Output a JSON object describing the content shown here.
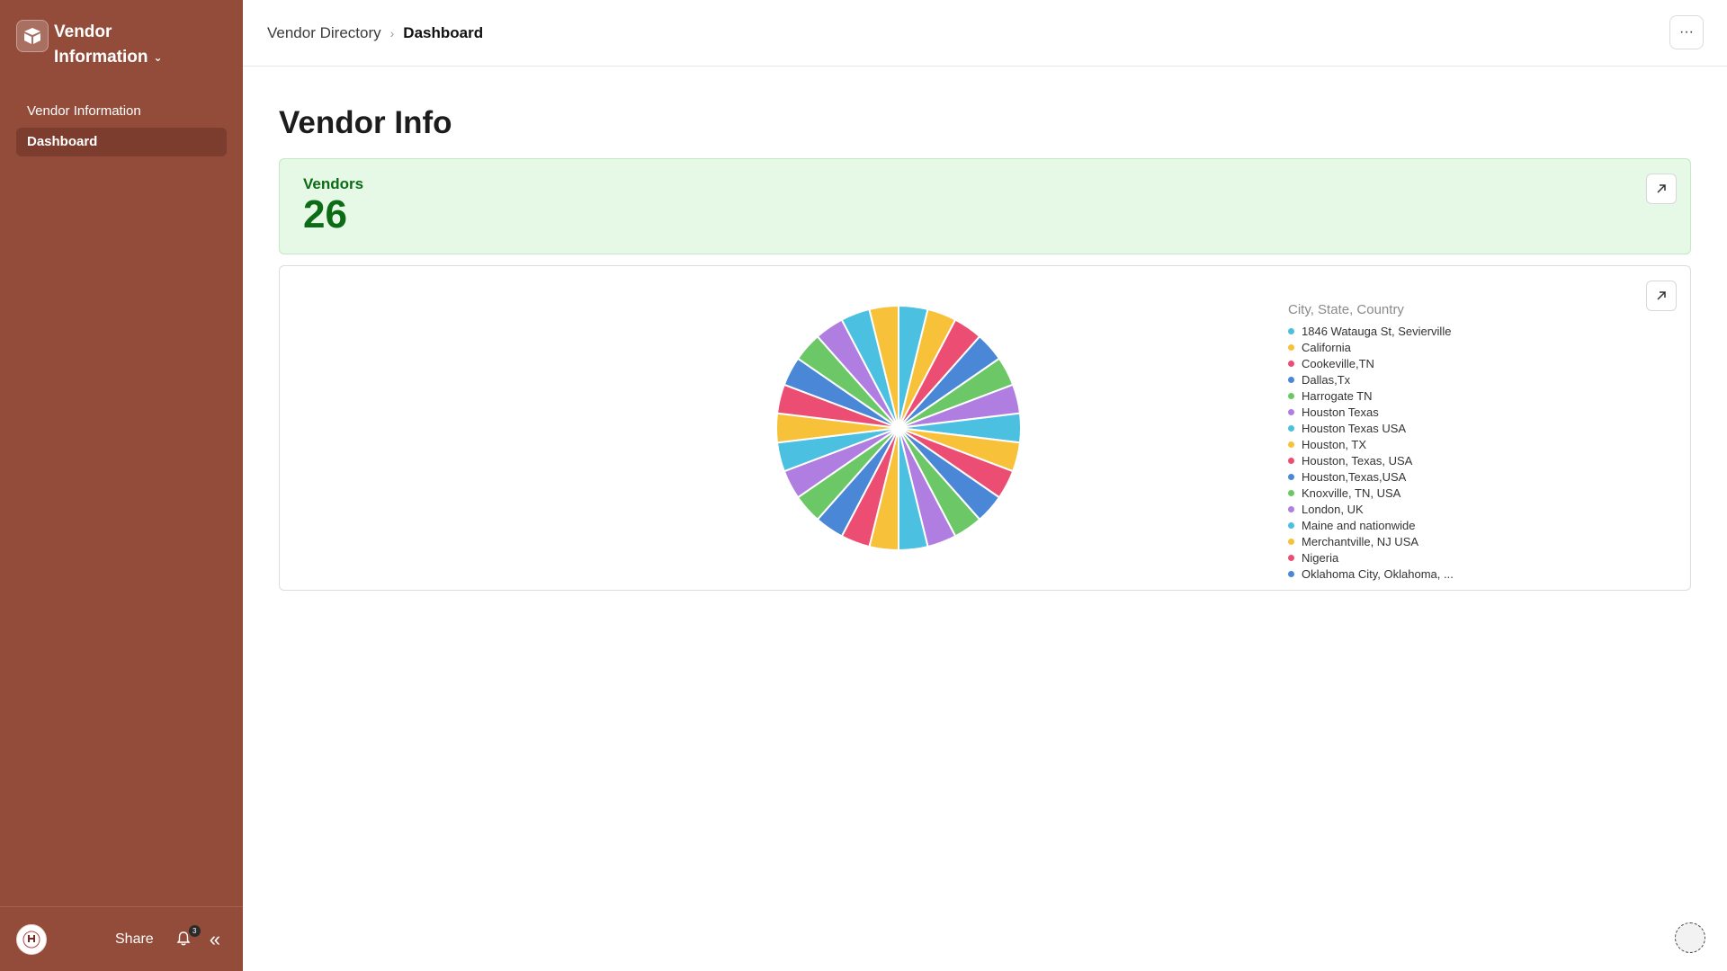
{
  "sidebar": {
    "brand_line1": "Vendor",
    "brand_line2": "Information",
    "items": [
      {
        "label": "Vendor Information",
        "active": false
      },
      {
        "label": "Dashboard",
        "active": true
      }
    ],
    "footer": {
      "share_label": "Share",
      "notification_count": "3",
      "bg_color": "#944c3a"
    }
  },
  "header": {
    "breadcrumb": [
      "Vendor Directory",
      "Dashboard"
    ],
    "more_label": "···"
  },
  "main": {
    "title": "Vendor Info",
    "metric": {
      "label": "Vendors",
      "value": "26",
      "color": "#0c6b15",
      "bg": "#e6f8e6"
    }
  },
  "chart_data": {
    "type": "pie",
    "legend_title": "City, State, Country",
    "colors": [
      "#4bc0e0",
      "#f8c13a",
      "#ec4d72",
      "#4a87d6",
      "#6cc866",
      "#b07ee0"
    ],
    "slices": [
      {
        "label": "1846 Watauga St, Sevierville",
        "value": 1
      },
      {
        "label": "California",
        "value": 1
      },
      {
        "label": "Cookeville,TN",
        "value": 1
      },
      {
        "label": "Dallas,Tx",
        "value": 1
      },
      {
        "label": "Harrogate TN",
        "value": 1
      },
      {
        "label": "Houston Texas",
        "value": 1
      },
      {
        "label": "Houston Texas USA",
        "value": 1
      },
      {
        "label": "Houston, TX",
        "value": 1
      },
      {
        "label": "Houston, Texas, USA",
        "value": 1
      },
      {
        "label": "Houston,Texas,USA",
        "value": 1
      },
      {
        "label": "Knoxville, TN, USA",
        "value": 1
      },
      {
        "label": "London, UK",
        "value": 1
      },
      {
        "label": "Maine and nationwide",
        "value": 1
      },
      {
        "label": "Merchantville, NJ USA",
        "value": 1
      },
      {
        "label": "Nigeria",
        "value": 1
      },
      {
        "label": "Oklahoma City, Oklahoma, ...",
        "value": 1
      },
      {
        "label": "",
        "value": 1
      },
      {
        "label": "",
        "value": 1
      },
      {
        "label": "",
        "value": 1
      },
      {
        "label": "",
        "value": 1
      },
      {
        "label": "",
        "value": 1
      },
      {
        "label": "",
        "value": 1
      },
      {
        "label": "",
        "value": 1
      },
      {
        "label": "",
        "value": 1
      },
      {
        "label": "",
        "value": 1
      },
      {
        "label": "",
        "value": 1
      }
    ]
  }
}
